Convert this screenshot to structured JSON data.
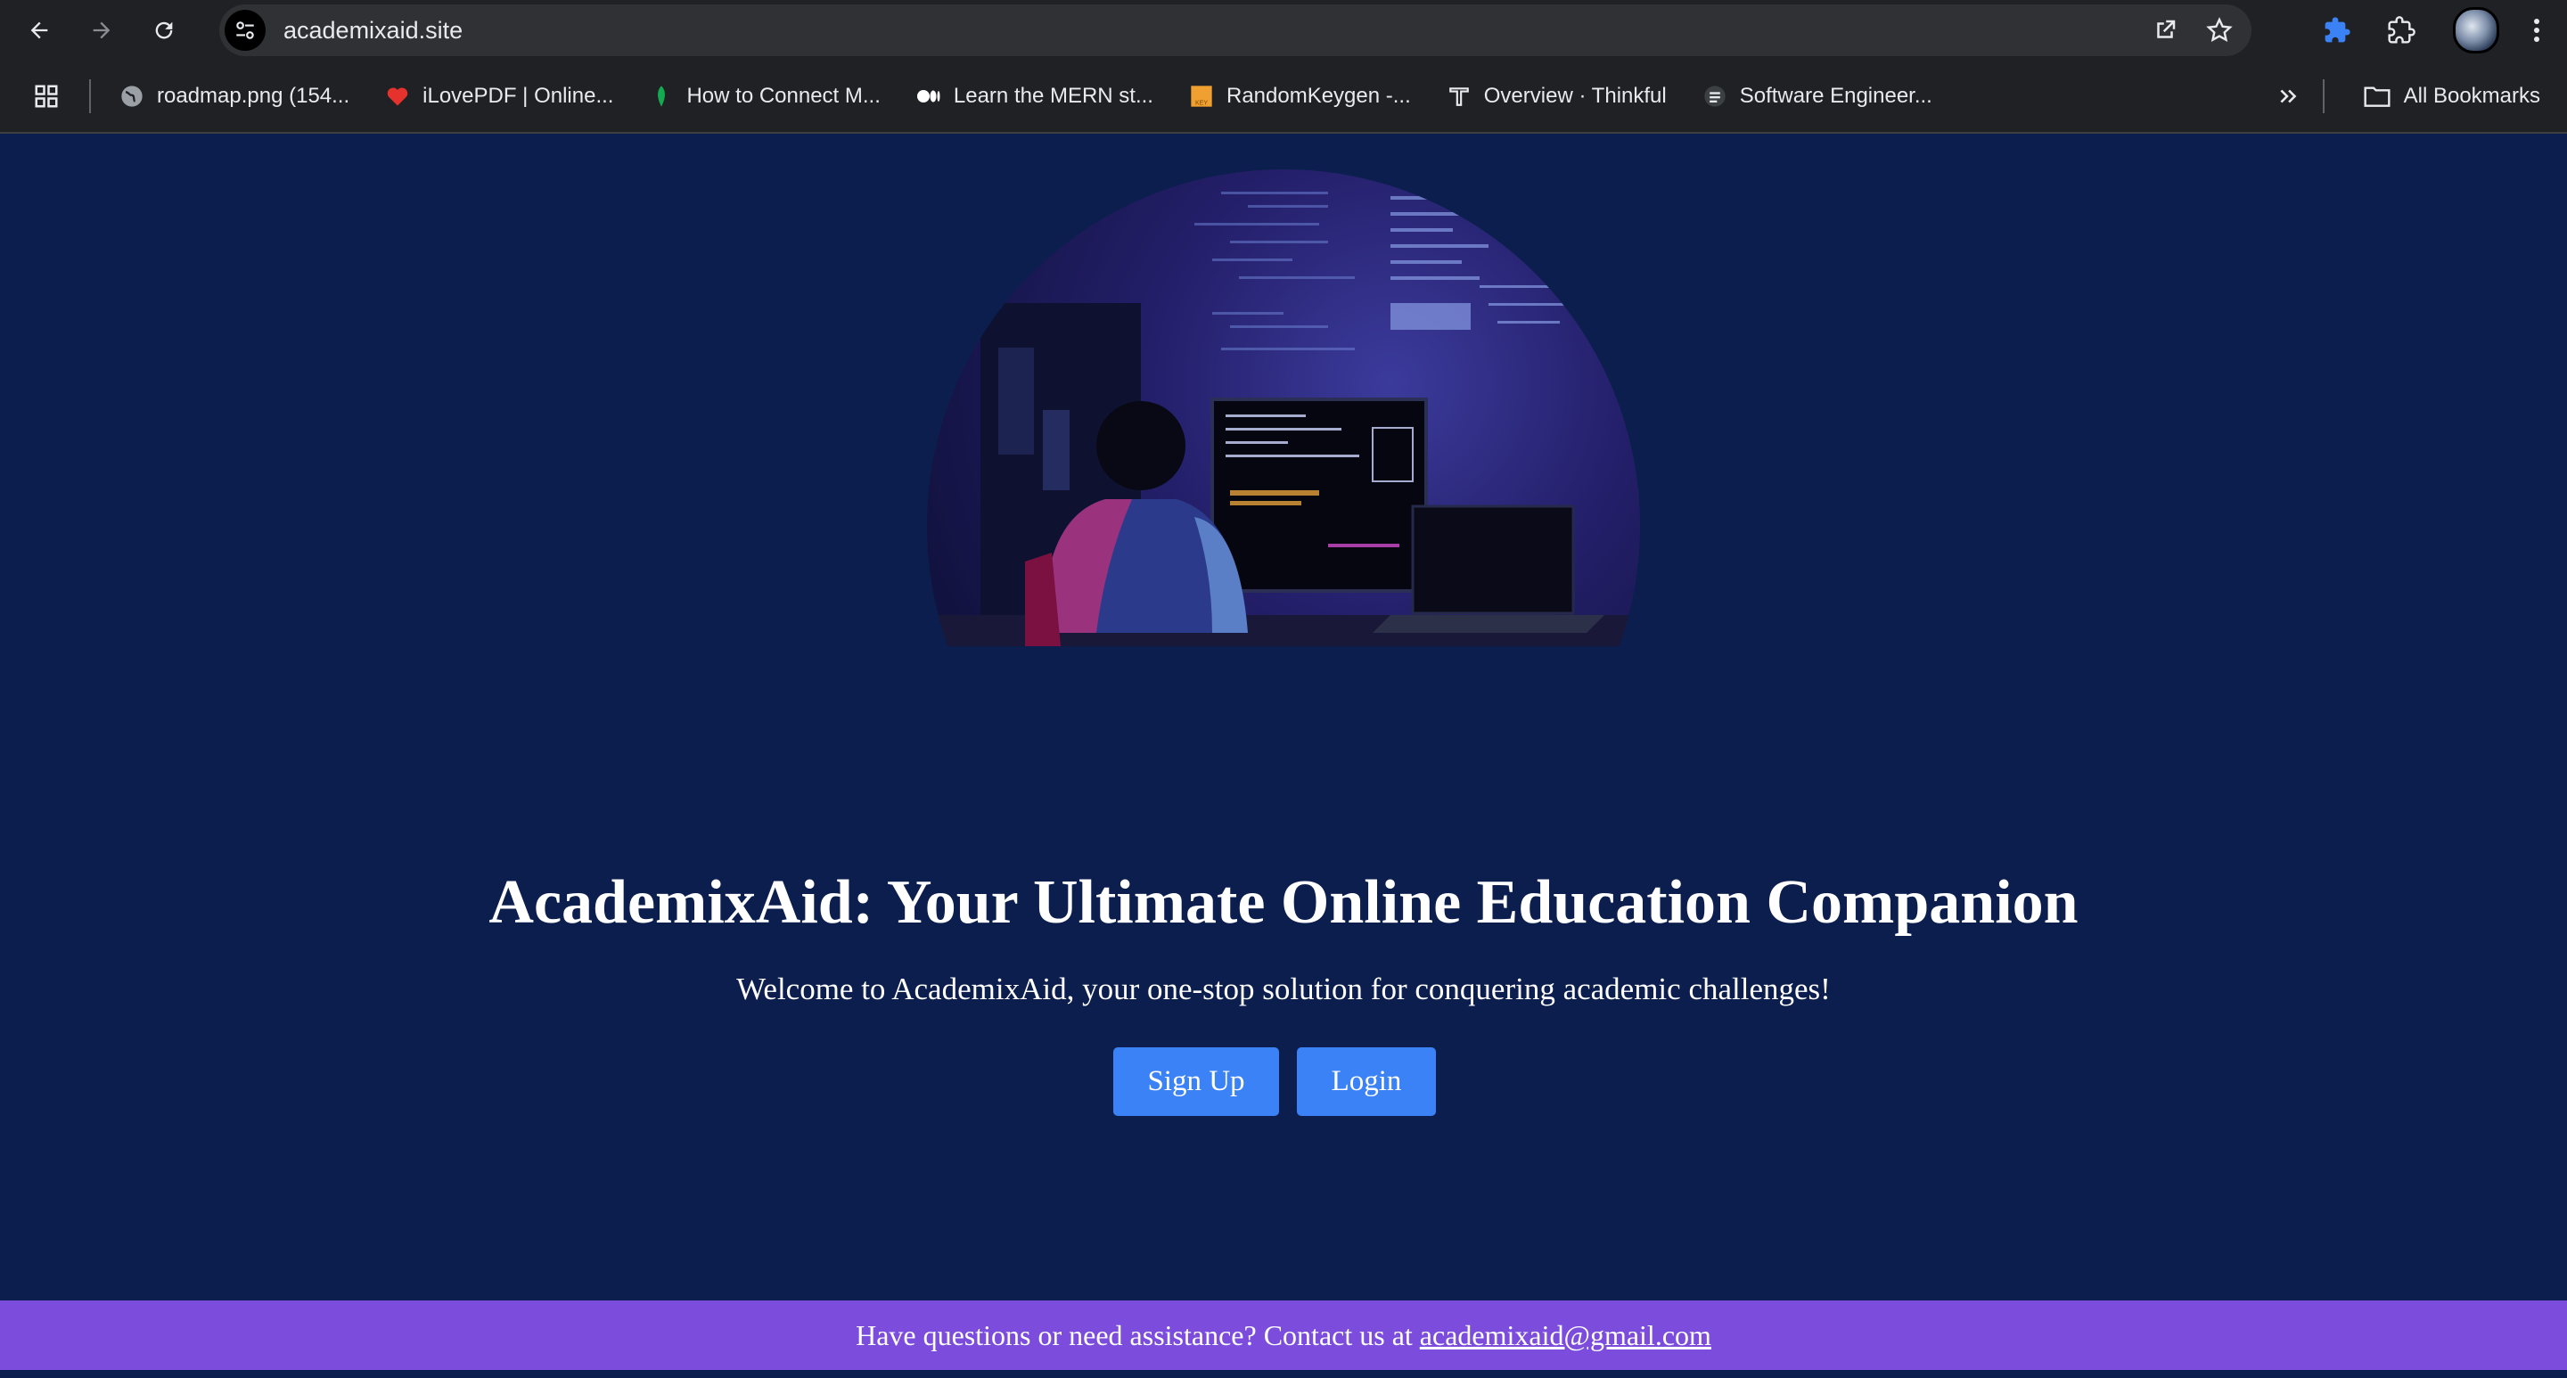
{
  "browser": {
    "url": "academixaid.site",
    "bookmarks": [
      {
        "label": "roadmap.png (154...",
        "icon": "globe-icon"
      },
      {
        "label": "iLovePDF | Online...",
        "icon": "heart-icon"
      },
      {
        "label": "How to Connect M...",
        "icon": "leaf-icon"
      },
      {
        "label": "Learn the MERN st...",
        "icon": "medium-icon"
      },
      {
        "label": "RandomKeygen -...",
        "icon": "key-icon"
      },
      {
        "label": "Overview · Thinkful",
        "icon": "thinkful-icon"
      },
      {
        "label": "Software Engineer...",
        "icon": "doc-icon"
      }
    ],
    "all_bookmarks": "All Bookmarks"
  },
  "page": {
    "headline": "AcademixAid: Your Ultimate Online Education Companion",
    "subheadline": "Welcome to AcademixAid, your one-stop solution for conquering academic challenges!",
    "signup_label": "Sign Up",
    "login_label": "Login",
    "footer_text": "Have questions or need assistance? Contact us at",
    "footer_email": "academixaid@gmail.com"
  },
  "colors": {
    "page_bg": "#0b1e4d",
    "button": "#3b82f6",
    "footer": "#7c4ddc",
    "chrome": "#202124"
  }
}
